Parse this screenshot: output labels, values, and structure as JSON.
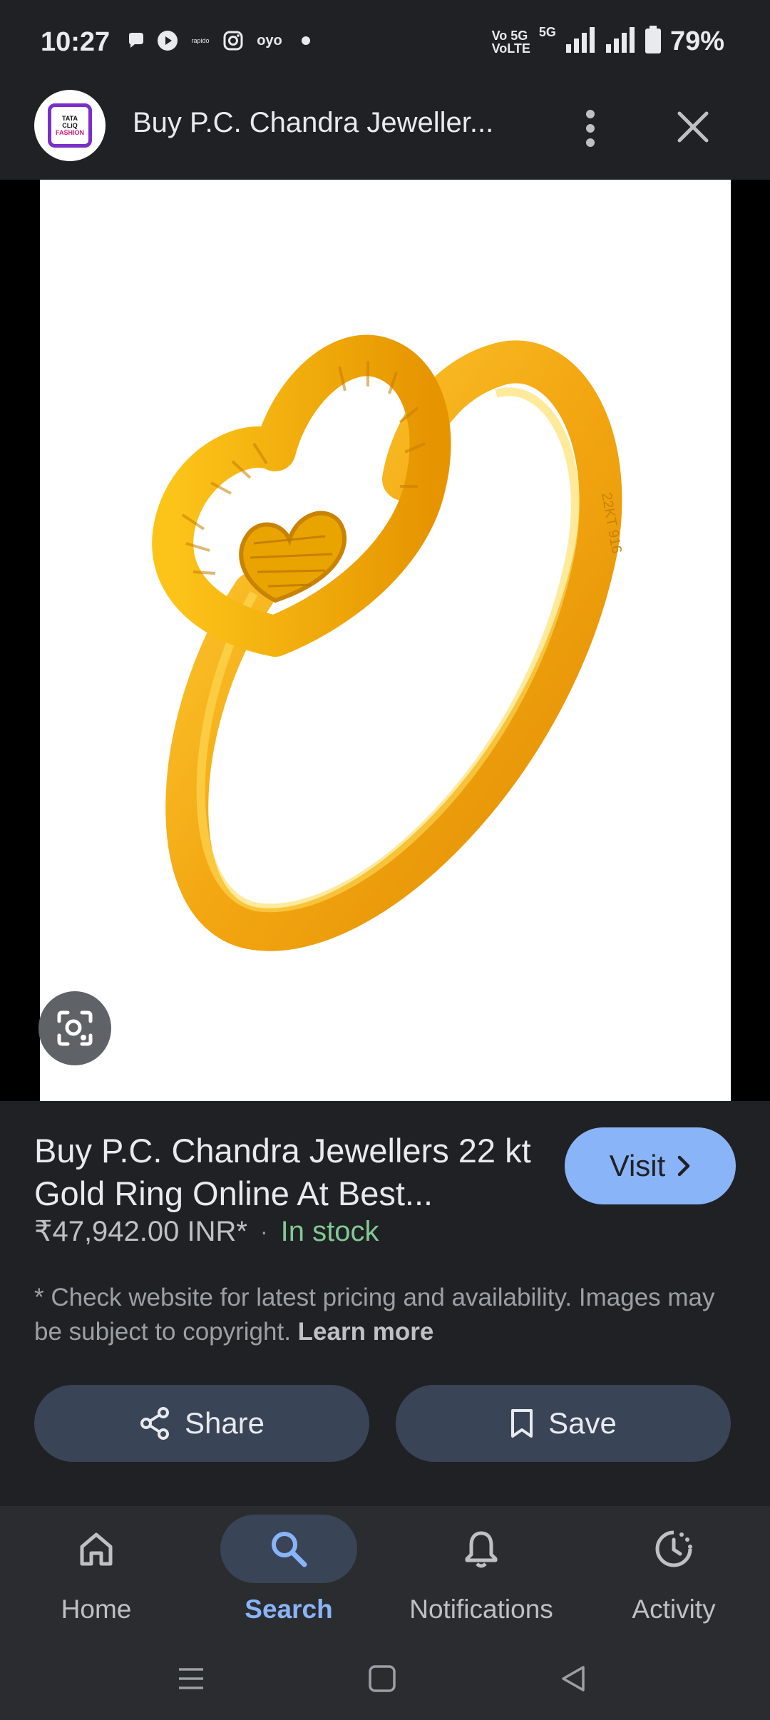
{
  "status_bar": {
    "time": "10:27",
    "network_label_top": "Vo 5G",
    "network_label_bottom": "VoLTE",
    "network_type": "5G",
    "battery_percent": "79%",
    "left_icons": [
      "chat-bubble-icon",
      "play-icon",
      "rapido-icon",
      "instagram-icon",
      "oyo-icon",
      "dot-icon"
    ],
    "oyo_text": "oyo",
    "rapido_text": "rapido"
  },
  "header": {
    "logo_text": [
      "TATA",
      "CLiQ",
      "FASHION"
    ],
    "title": "Buy P.C. Chandra Jeweller..."
  },
  "product": {
    "title": "Buy P.C. Chandra Jewellers 22 kt Gold Ring Online At Best...",
    "visit_label": "Visit",
    "price": "₹47,942.00 INR*",
    "separator": "·",
    "stock": "In stock",
    "disclaimer": "* Check website for latest pricing and availability. Images may be subject to copyright.",
    "learn_more": "Learn more",
    "share_label": "Share",
    "save_label": "Save",
    "image_engraving": "22KT 916"
  },
  "bottom_nav": {
    "items": [
      {
        "label": "Home",
        "icon": "home-icon"
      },
      {
        "label": "Search",
        "icon": "search-icon",
        "active": true
      },
      {
        "label": "Notifications",
        "icon": "bell-icon"
      },
      {
        "label": "Activity",
        "icon": "activity-icon"
      }
    ]
  },
  "colors": {
    "background": "#202124",
    "accent": "#8ab4f8",
    "button_bg": "#394457",
    "stock_green": "#81c995",
    "gold": "#f0b429"
  }
}
